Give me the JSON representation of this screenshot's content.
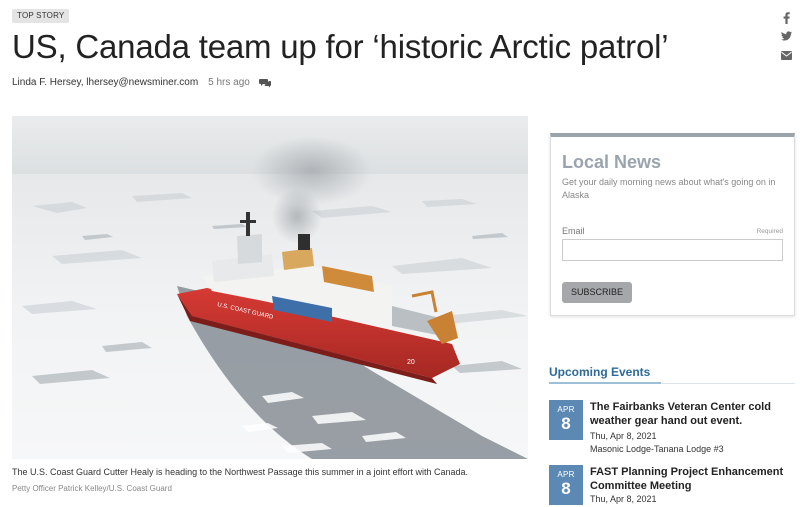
{
  "article": {
    "badge": "TOP STORY",
    "headline": "US, Canada team up for ‘historic Arctic patrol’",
    "author": "Linda F. Hersey, lhersey@newsminer.com",
    "time": "5 hrs ago",
    "caption": "The U.S. Coast Guard Cutter Healy is heading to the Northwest Passage this summer in a joint effort with Canada.",
    "credit": "Petty Officer Patrick Kelley/U.S. Coast Guard",
    "ship_hull_text": "U.S. COAST GUARD",
    "ship_number": "20"
  },
  "share": {
    "facebook_icon": "f",
    "twitter_icon": "twitter-bird",
    "email_icon": "envelope"
  },
  "newsletter": {
    "title": "Local News",
    "description": "Get your daily morning news about what's going on in Alaska",
    "email_label": "Email",
    "required_label": "Required",
    "email_value": "",
    "button_label": "SUBSCRIBE"
  },
  "events": {
    "heading": "Upcoming Events",
    "items": [
      {
        "month": "APR",
        "day": "8",
        "title": "The Fairbanks Veteran Center cold weather gear hand out event.",
        "date": "Thu, Apr 8, 2021",
        "venue": "Masonic Lodge-Tanana Lodge #3"
      },
      {
        "month": "APR",
        "day": "8",
        "title": "FAST Planning Project Enhancement Committee Meeting",
        "date": "Thu, Apr 8, 2021",
        "venue": ""
      }
    ]
  },
  "colors": {
    "accent_blue": "#2e6b97",
    "date_box": "#5c89b3",
    "newsletter_title": "#9aa4ae",
    "button_gray": "#a5a7ab",
    "ship_red": "#c8322e"
  }
}
